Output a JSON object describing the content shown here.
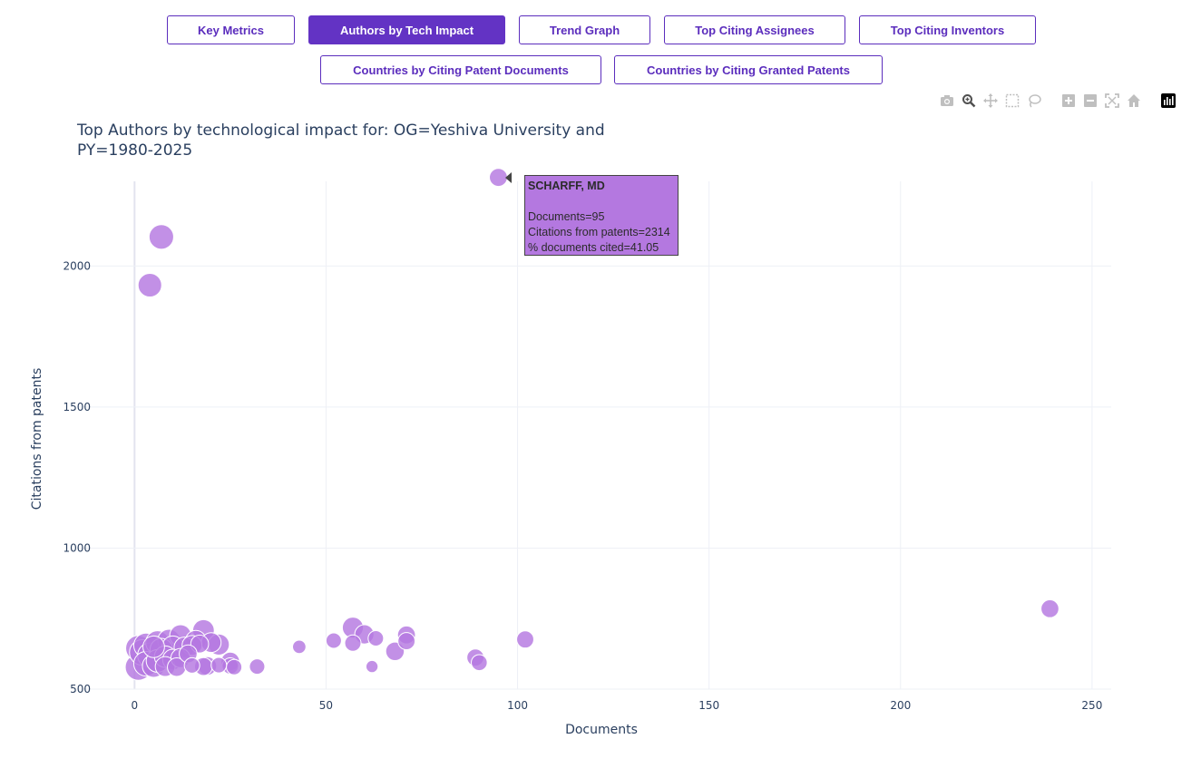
{
  "tabs": [
    {
      "label": "Key Metrics",
      "active": false
    },
    {
      "label": "Authors by Tech Impact",
      "active": true
    },
    {
      "label": "Trend Graph",
      "active": false
    },
    {
      "label": "Top Citing Assignees",
      "active": false
    },
    {
      "label": "Top Citing Inventors",
      "active": false
    },
    {
      "label": "Countries by Citing Patent Documents",
      "active": false
    },
    {
      "label": "Countries by Citing Granted Patents",
      "active": false
    }
  ],
  "colors": {
    "accent": "#6333c4",
    "marker": "#b478e0",
    "grid": "#eef0f6",
    "text": "#2a3f5f"
  },
  "modebar_icons": [
    "camera-icon",
    "zoom-icon",
    "pan-icon",
    "box-select-icon",
    "lasso-icon",
    "zoom-in-icon",
    "zoom-out-icon",
    "autoscale-icon",
    "reset-axes-icon",
    "plotly-logo-icon"
  ],
  "chart_data": {
    "type": "scatter",
    "title_line1": "Top Authors by technological impact for: OG=Yeshiva University and",
    "title_line2": "PY=1980-2025",
    "xlabel": "Documents",
    "ylabel": "Citations from patents",
    "xlim": [
      -15,
      255
    ],
    "ylim": [
      500,
      2300
    ],
    "xticks": [
      0,
      50,
      100,
      150,
      200,
      250
    ],
    "yticks": [
      500,
      1000,
      1500,
      2000
    ],
    "grid": true,
    "size_note": "marker size encodes % documents cited",
    "points": [
      {
        "x": 95,
        "y": 2314,
        "s": 41
      },
      {
        "x": 7,
        "y": 2103,
        "s": 100
      },
      {
        "x": 4,
        "y": 1932,
        "s": 90
      },
      {
        "x": 239,
        "y": 785,
        "s": 40
      },
      {
        "x": 57,
        "y": 718,
        "s": 65
      },
      {
        "x": 60,
        "y": 694,
        "s": 50
      },
      {
        "x": 63,
        "y": 680,
        "s": 25
      },
      {
        "x": 71,
        "y": 692,
        "s": 40
      },
      {
        "x": 71,
        "y": 670,
        "s": 35
      },
      {
        "x": 57,
        "y": 663,
        "s": 30
      },
      {
        "x": 52,
        "y": 672,
        "s": 25
      },
      {
        "x": 43,
        "y": 650,
        "s": 15
      },
      {
        "x": 68,
        "y": 634,
        "s": 45
      },
      {
        "x": 102,
        "y": 676,
        "s": 35
      },
      {
        "x": 89,
        "y": 612,
        "s": 35
      },
      {
        "x": 90,
        "y": 594,
        "s": 28
      },
      {
        "x": 62,
        "y": 580,
        "s": 10
      },
      {
        "x": 32,
        "y": 580,
        "s": 25
      },
      {
        "x": 18,
        "y": 708,
        "s": 70
      },
      {
        "x": 12,
        "y": 690,
        "s": 70
      },
      {
        "x": 16,
        "y": 672,
        "s": 60
      },
      {
        "x": 20,
        "y": 665,
        "s": 55
      },
      {
        "x": 22,
        "y": 658,
        "s": 65
      },
      {
        "x": 9,
        "y": 672,
        "s": 80
      },
      {
        "x": 6,
        "y": 665,
        "s": 90
      },
      {
        "x": 3,
        "y": 655,
        "s": 100
      },
      {
        "x": 1,
        "y": 645,
        "s": 110
      },
      {
        "x": 2,
        "y": 630,
        "s": 110
      },
      {
        "x": 4,
        "y": 620,
        "s": 100
      },
      {
        "x": 7,
        "y": 640,
        "s": 80
      },
      {
        "x": 10,
        "y": 650,
        "s": 70
      },
      {
        "x": 13,
        "y": 648,
        "s": 60
      },
      {
        "x": 15,
        "y": 655,
        "s": 55
      },
      {
        "x": 17,
        "y": 660,
        "s": 40
      },
      {
        "x": 25,
        "y": 598,
        "s": 45
      },
      {
        "x": 25,
        "y": 582,
        "s": 30
      },
      {
        "x": 26,
        "y": 578,
        "s": 25
      },
      {
        "x": 22,
        "y": 585,
        "s": 25
      },
      {
        "x": 19,
        "y": 582,
        "s": 45
      },
      {
        "x": 18,
        "y": 580,
        "s": 40
      },
      {
        "x": 15,
        "y": 584,
        "s": 25
      },
      {
        "x": 11,
        "y": 578,
        "s": 45
      },
      {
        "x": 8,
        "y": 580,
        "s": 55
      },
      {
        "x": 5,
        "y": 582,
        "s": 80
      },
      {
        "x": 3,
        "y": 590,
        "s": 100
      },
      {
        "x": 1,
        "y": 578,
        "s": 120
      },
      {
        "x": 6,
        "y": 600,
        "s": 80
      },
      {
        "x": 10,
        "y": 605,
        "s": 60
      },
      {
        "x": 12,
        "y": 610,
        "s": 50
      },
      {
        "x": 8,
        "y": 615,
        "s": 70
      },
      {
        "x": 14,
        "y": 625,
        "s": 40
      },
      {
        "x": 5,
        "y": 650,
        "s": 70
      }
    ],
    "hover": {
      "name": "SCHARFF, MD",
      "lines": [
        "Documents=95",
        "Citations from patents=2314",
        "% documents cited=41.05"
      ]
    }
  }
}
